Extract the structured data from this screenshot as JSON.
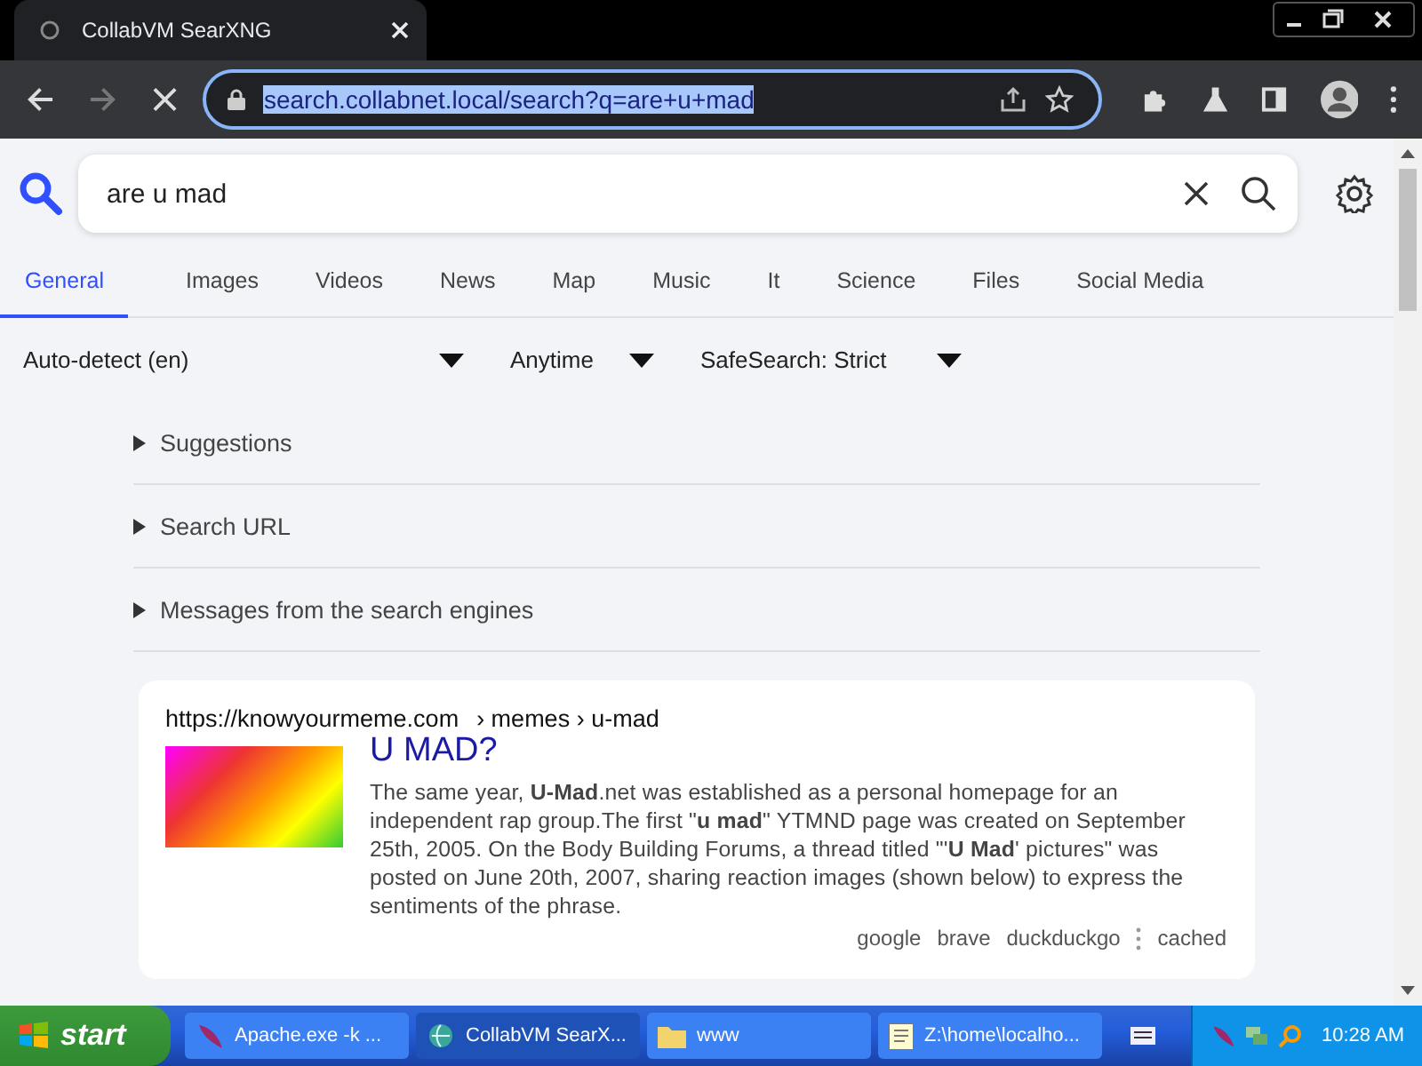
{
  "browser": {
    "tab": {
      "title": "CollabVM SearXNG"
    },
    "address": {
      "value": "search.collabnet.local/search?q=are+u+mad",
      "text_selected": true
    }
  },
  "search": {
    "value": "are u mad"
  },
  "categories": [
    {
      "label": "General",
      "selected": true
    },
    {
      "label": "Images",
      "selected": false
    },
    {
      "label": "Videos",
      "selected": false
    },
    {
      "label": "News",
      "selected": false
    },
    {
      "label": "Map",
      "selected": false
    },
    {
      "label": "Music",
      "selected": false
    },
    {
      "label": "It",
      "selected": false
    },
    {
      "label": "Science",
      "selected": false
    },
    {
      "label": "Files",
      "selected": false
    },
    {
      "label": "Social Media",
      "selected": false
    }
  ],
  "filters": [
    {
      "label": "Auto-detect (en)"
    },
    {
      "label": "Anytime"
    },
    {
      "label": "SafeSearch: Strict"
    }
  ],
  "sections": [
    {
      "label": "Suggestions",
      "expanded": false
    },
    {
      "label": "Search URL",
      "expanded": false
    },
    {
      "label": "Messages from the search engines",
      "expanded": false
    }
  ],
  "results": [
    {
      "url": "https://knowyourmeme.com",
      "path": "› memes › u-mad",
      "title": "U MAD?",
      "content": "The same year, **U-Mad**.net was established as a personal homepage for an independent rap group.The first \"**u mad**\" YTMND page was created on September 25th, 2005. On the Body Building Forums, a thread titled \"'**U Mad**' pictures\" was posted on June 20th, 2007, sharing reaction images (shown below) to express the sentiments of the phrase.",
      "engines": [
        "google",
        "brave",
        "duckduckgo"
      ],
      "cached": "cached"
    }
  ],
  "taskbar": {
    "start": "start",
    "tasks": [
      {
        "label": "Apache.exe -k ...",
        "kind": "feather",
        "selected": false
      },
      {
        "label": "CollabVM SearX...",
        "kind": "browser",
        "selected": true
      },
      {
        "label": "www",
        "kind": "folder",
        "selected": false
      },
      {
        "label": "Z:\\home\\localho...",
        "kind": "notepad",
        "selected": false
      }
    ],
    "clock": "10:28 AM"
  }
}
